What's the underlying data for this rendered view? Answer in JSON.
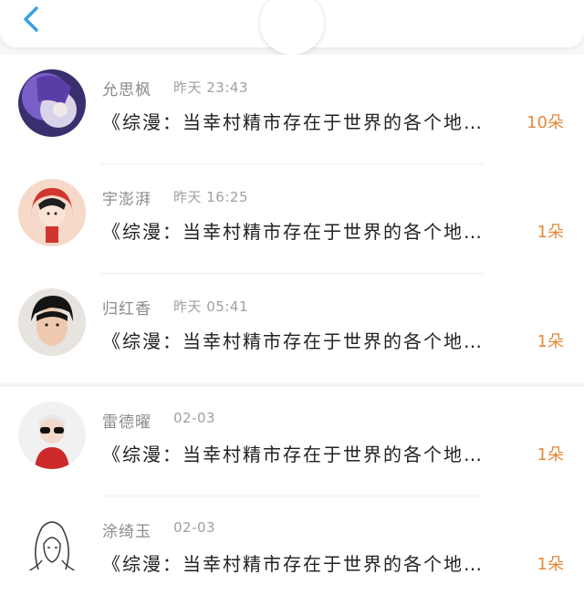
{
  "header": {
    "back_icon": "chevron-left-icon",
    "accent": "#3aa0e6"
  },
  "items": [
    {
      "name": "允思枫",
      "time": "昨天 23:43",
      "title": "《综漫：当幸村精市存在于世界的各个地…",
      "count": "10朵"
    },
    {
      "name": "宇澎湃",
      "time": "昨天 16:25",
      "title": "《综漫：当幸村精市存在于世界的各个地…",
      "count": "1朵"
    },
    {
      "name": "归红香",
      "time": "昨天 05:41",
      "title": "《综漫：当幸村精市存在于世界的各个地…",
      "count": "1朵"
    },
    {
      "name": "雷德曜",
      "time": "02-03",
      "title": "《综漫：当幸村精市存在于世界的各个地…",
      "count": "1朵"
    },
    {
      "name": "涂绮玉",
      "time": "02-03",
      "title": "《综漫：当幸村精市存在于世界的各个地…",
      "count": "1朵"
    }
  ]
}
